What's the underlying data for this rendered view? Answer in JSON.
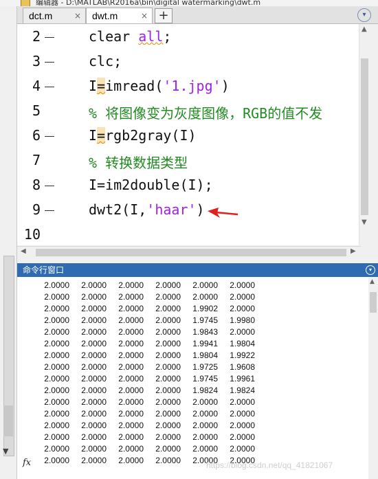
{
  "window": {
    "title": "编辑器 - D:\\MATLAB\\R2016a\\bin\\digital watermarking\\dwt.m"
  },
  "tabs": [
    {
      "label": "dct.m",
      "close": "×"
    },
    {
      "label": "dwt.m",
      "close": "×"
    }
  ],
  "tab_add": "+",
  "editor": {
    "lines": [
      {
        "num": "2",
        "has_dash": true
      },
      {
        "num": "3",
        "has_dash": true
      },
      {
        "num": "4",
        "has_dash": true
      },
      {
        "num": "5",
        "has_dash": false
      },
      {
        "num": "6",
        "has_dash": true
      },
      {
        "num": "7",
        "has_dash": false
      },
      {
        "num": "8",
        "has_dash": true
      },
      {
        "num": "9",
        "has_dash": true
      },
      {
        "num": "10",
        "has_dash": false
      }
    ],
    "code": {
      "l2_a": "clear ",
      "l2_b": "all",
      "l2_c": ";",
      "l3": "clc;",
      "l4_a": "I",
      "l4_b": "=",
      "l4_c": "imread(",
      "l4_d": "'1.jpg'",
      "l4_e": ")",
      "l5": "% 将图像变为灰度图像，RGB的值不发",
      "l6_a": "I",
      "l6_b": "=",
      "l6_c": "rgb2gray(I)",
      "l7": "% 转换数据类型",
      "l8": "I=im2double(I);",
      "l9_a": "dwt2(I,",
      "l9_b": "'haar'",
      "l9_c": ")"
    }
  },
  "command_window": {
    "title": "命令行窗口",
    "rows": [
      [
        "2.0000",
        "2.0000",
        "2.0000",
        "2.0000",
        "2.0000",
        "2.0000"
      ],
      [
        "2.0000",
        "2.0000",
        "2.0000",
        "2.0000",
        "2.0000",
        "2.0000"
      ],
      [
        "2.0000",
        "2.0000",
        "2.0000",
        "2.0000",
        "1.9902",
        "2.0000"
      ],
      [
        "2.0000",
        "2.0000",
        "2.0000",
        "2.0000",
        "1.9745",
        "1.9980"
      ],
      [
        "2.0000",
        "2.0000",
        "2.0000",
        "2.0000",
        "1.9843",
        "2.0000"
      ],
      [
        "2.0000",
        "2.0000",
        "2.0000",
        "2.0000",
        "1.9941",
        "1.9804"
      ],
      [
        "2.0000",
        "2.0000",
        "2.0000",
        "2.0000",
        "1.9804",
        "1.9922"
      ],
      [
        "2.0000",
        "2.0000",
        "2.0000",
        "2.0000",
        "1.9725",
        "1.9608"
      ],
      [
        "2.0000",
        "2.0000",
        "2.0000",
        "2.0000",
        "1.9745",
        "1.9961"
      ],
      [
        "2.0000",
        "2.0000",
        "2.0000",
        "2.0000",
        "1.9824",
        "1.9824"
      ],
      [
        "2.0000",
        "2.0000",
        "2.0000",
        "2.0000",
        "2.0000",
        "2.0000"
      ],
      [
        "2.0000",
        "2.0000",
        "2.0000",
        "2.0000",
        "2.0000",
        "2.0000"
      ],
      [
        "2.0000",
        "2.0000",
        "2.0000",
        "2.0000",
        "2.0000",
        "2.0000"
      ],
      [
        "2.0000",
        "2.0000",
        "2.0000",
        "2.0000",
        "2.0000",
        "2.0000"
      ],
      [
        "2.0000",
        "2.0000",
        "2.0000",
        "2.0000",
        "2.0000",
        "2.0000"
      ],
      [
        "2.0000",
        "2.0000",
        "2.0000",
        "2.0000",
        "2.0000",
        "2.0000"
      ]
    ],
    "prompt_icon": "fx"
  },
  "watermark": "https://blog.csdn.net/qq_41821067",
  "colors": {
    "command_header": "#2f6bb0",
    "keyword": "#a020f0",
    "comment": "#228b22",
    "arrow": "#e02020"
  }
}
